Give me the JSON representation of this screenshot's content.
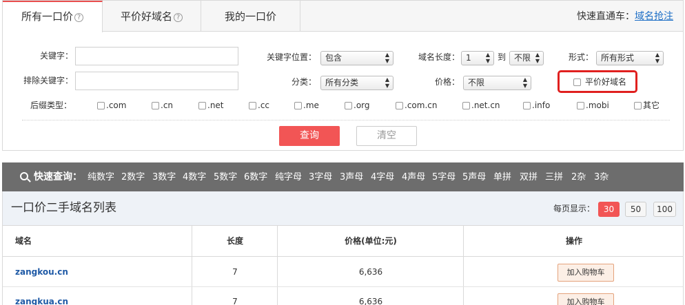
{
  "tabs": [
    {
      "label": "所有一口价",
      "help": "?"
    },
    {
      "label": "平价好域名",
      "help": "?"
    },
    {
      "label": "我的一口价"
    }
  ],
  "express": {
    "label": "快速直通车：",
    "link": "域名抢注"
  },
  "form": {
    "keyword_label": "关键字：",
    "exclude_label": "排除关键字：",
    "keyword_pos_label": "关键字位置：",
    "keyword_pos_value": "包含",
    "length_label": "域名长度：",
    "length_min": "1",
    "length_to": "到",
    "length_max": "不限",
    "form_label": "形式：",
    "form_value": "所有形式",
    "category_label": "分类：",
    "category_value": "所有分类",
    "price_label": "价格：",
    "price_value": "不限",
    "good_domain_label": "平价好域名",
    "suffix_label": "后缀类型：",
    "suffixes": [
      ".com",
      ".cn",
      ".net",
      ".cc",
      ".me",
      ".org",
      ".com.cn",
      ".net.cn",
      ".info",
      ".mobi",
      "其它"
    ],
    "query_button": "查询",
    "clear_button": "清空"
  },
  "quick": {
    "title": "快速查询：",
    "items": [
      "纯数字",
      "2数字",
      "3数字",
      "4数字",
      "5数字",
      "6数字",
      "纯字母",
      "3字母",
      "3声母",
      "4字母",
      "4声母",
      "5字母",
      "5声母",
      "单拼",
      "双拼",
      "三拼",
      "2杂",
      "3杂"
    ]
  },
  "list": {
    "title": "一口价二手域名列表",
    "perpage_label": "每页显示：",
    "perpage_options": [
      "30",
      "50",
      "100"
    ],
    "perpage_selected": "30",
    "headers": {
      "domain": "域名",
      "length": "长度",
      "price": "价格(单位:元)",
      "action": "操作"
    },
    "rows": [
      {
        "domain": "zangkou.cn",
        "length": "7",
        "price": "6,636",
        "action": "加入购物车"
      },
      {
        "domain": "zangkua.cn",
        "length": "7",
        "price": "6,636",
        "action": "加入购物车"
      }
    ]
  },
  "colors": {
    "accent": "#f25555",
    "highlight_border": "#e0201f",
    "link": "#1e6fc6",
    "quickbar": "#6d6d6d"
  }
}
